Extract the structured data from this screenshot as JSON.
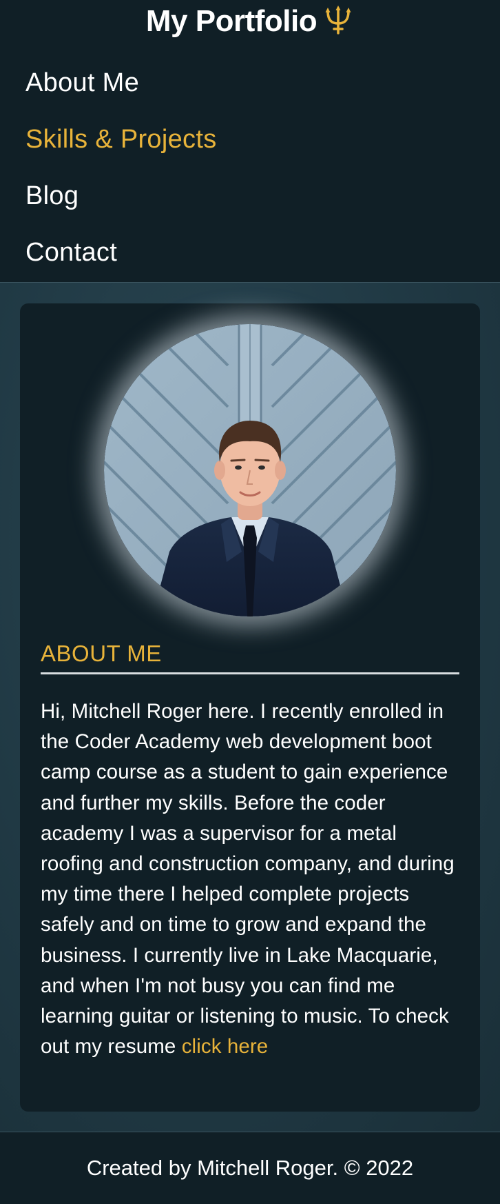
{
  "header": {
    "title": "My Portfolio",
    "title_icon": "trident-icon"
  },
  "nav": {
    "items": [
      {
        "label": "About Me"
      },
      {
        "label": "Skills & Projects",
        "active": true
      },
      {
        "label": "Blog"
      },
      {
        "label": "Contact"
      }
    ]
  },
  "about": {
    "heading": "ABOUT ME",
    "bio_text": "Hi, Mitchell Roger here. I recently enrolled in the Coder Academy web development boot camp course as a student to gain experience and further my skills. Before the coder academy I was a supervisor for a metal roofing and construction company, and during my time there I helped complete projects safely and on time to grow and expand the business. I currently live in Lake Macquarie, and when I'm not busy you can find me learning guitar or listening to music. To check out my resume ",
    "resume_link_label": "click here"
  },
  "footer": {
    "text": "Created by Mitchell Roger. © 2022"
  },
  "colors": {
    "background": "#101f26",
    "accent": "#e8b33a",
    "text": "#ffffff"
  }
}
